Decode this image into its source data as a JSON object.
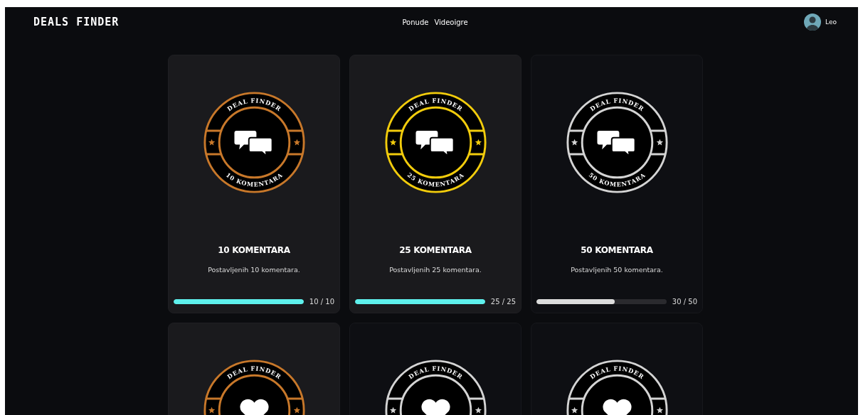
{
  "header": {
    "logo": "DEALS FINDER",
    "nav": [
      {
        "label": "Ponude"
      },
      {
        "label": "Videoigre"
      }
    ],
    "user": {
      "name": "Leo"
    }
  },
  "achievements": [
    {
      "badge_top": "DEAL FINDER",
      "badge_bottom": "10 KOMENTARA",
      "kind": "comments",
      "color": "#c8782a",
      "earned": true,
      "title": "10 KOMENTARA",
      "description": "Postavljenih 10 komentara.",
      "level": 1,
      "progress": "10 / 10"
    },
    {
      "badge_top": "DEAL FINDER",
      "badge_bottom": "25 KOMENTARA",
      "kind": "comments",
      "color": "#f2cc0c",
      "earned": true,
      "title": "25 KOMENTARA",
      "description": "Postavljenih 25 komentara.",
      "level": 1,
      "progress": "25 / 25"
    },
    {
      "badge_top": "DEAL FINDER",
      "badge_bottom": "50 KOMENTARA",
      "kind": "comments",
      "color": "#d4d4d4",
      "earned": false,
      "title": "50 KOMENTARA",
      "description": "Postavljenih 50 komentara.",
      "level": 0.6,
      "progress": "30 / 50"
    },
    {
      "badge_top": "DEAL FINDER",
      "kind": "heart",
      "color": "#c8782a",
      "earned": true
    },
    {
      "badge_top": "DEAL FINDER",
      "kind": "heart",
      "color": "#d4d4d4",
      "earned": false
    },
    {
      "badge_top": "DEAL FINDER",
      "kind": "heart",
      "color": "#d4d4d4",
      "earned": false
    }
  ]
}
